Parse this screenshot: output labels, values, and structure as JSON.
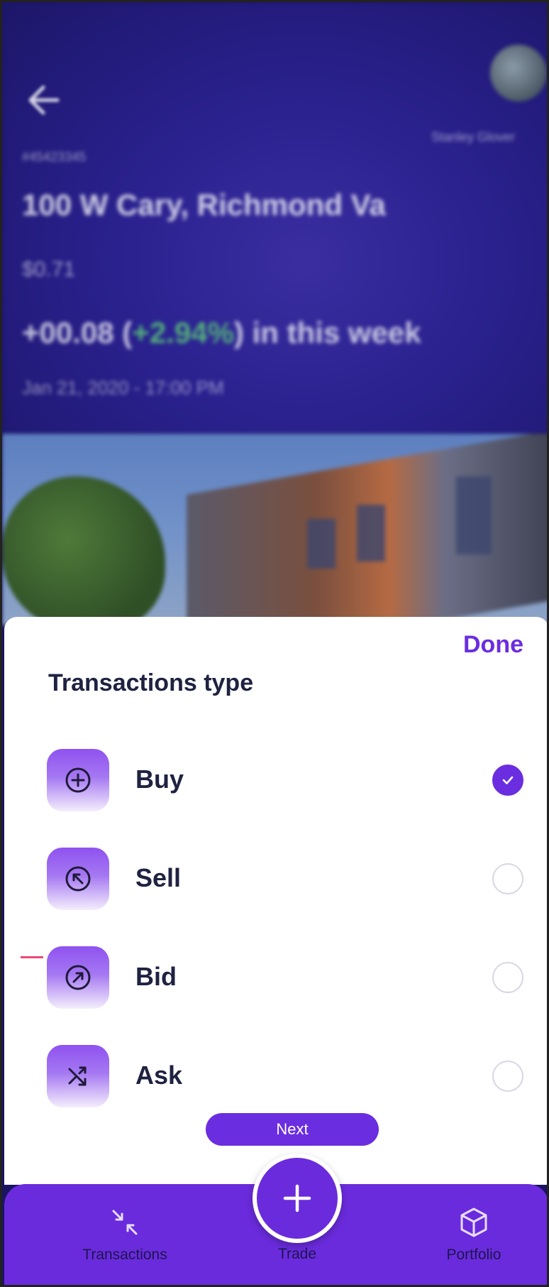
{
  "header": {
    "user_name": "Stanley Glover",
    "ticker": "#45423345",
    "property_title": "100 W Cary, Richmond Va",
    "price": "$0.71",
    "change_prefix": "+00.08 (",
    "change_pct": "+2.94%",
    "change_suffix": ") in this week",
    "date": "Jan 21, 2020 - 17:00 PM"
  },
  "sheet": {
    "done_label": "Done",
    "title": "Transactions type",
    "options": [
      {
        "label": "Buy",
        "icon": "plus-circle-icon",
        "selected": true
      },
      {
        "label": "Sell",
        "icon": "arrow-up-left-circle-icon",
        "selected": false
      },
      {
        "label": "Bid",
        "icon": "arrow-up-right-circle-icon",
        "selected": false
      },
      {
        "label": "Ask",
        "icon": "shuffle-icon",
        "selected": false
      }
    ],
    "next_label": "Next"
  },
  "nav": {
    "transactions_label": "Transactions",
    "trade_label": "Trade",
    "portfolio_label": "Portfolio"
  },
  "colors": {
    "accent": "#6b2de0",
    "header_bg": "#2b2290",
    "text_dark": "#1f2240"
  }
}
